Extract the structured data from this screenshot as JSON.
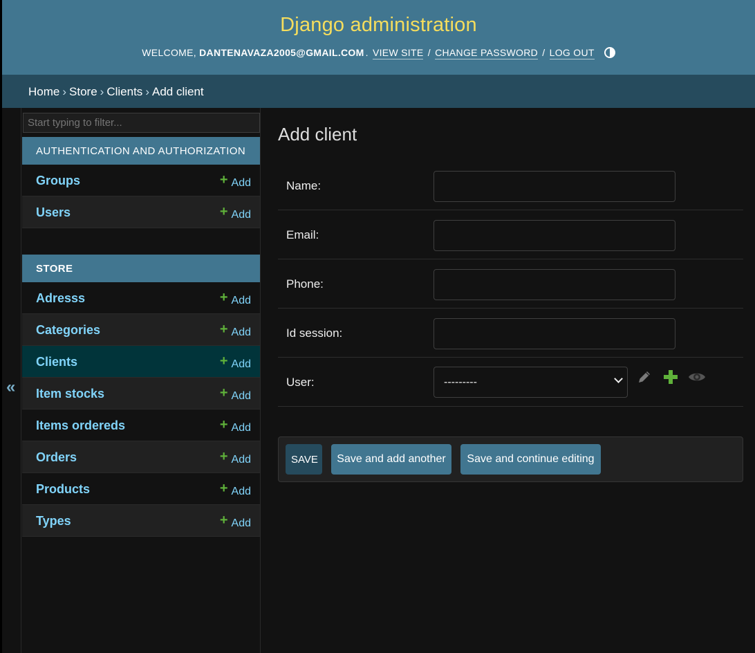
{
  "header": {
    "site_name": "Django administration",
    "welcome": "Welcome,",
    "user": "dantenavaza2005@gmail.com",
    "view_site": "View site",
    "change_password": "Change password",
    "log_out": "Log out"
  },
  "breadcrumbs": {
    "home": "Home",
    "store": "Store",
    "clients": "Clients",
    "current": "Add client",
    "separator": "›"
  },
  "sidebar": {
    "filter_placeholder": "Start typing to filter...",
    "collapse_icon": "«",
    "add_label": "Add",
    "auth_caption": "Authentication and Authorization",
    "auth_models": [
      {
        "label": "Groups"
      },
      {
        "label": "Users"
      }
    ],
    "store_caption": "Store",
    "store_models": [
      {
        "label": "Adresss"
      },
      {
        "label": "Categories"
      },
      {
        "label": "Clients",
        "current": true
      },
      {
        "label": "Item stocks"
      },
      {
        "label": "Items ordereds"
      },
      {
        "label": "Orders"
      },
      {
        "label": "Products"
      },
      {
        "label": "Types"
      }
    ]
  },
  "content": {
    "title": "Add client",
    "fields": {
      "name_label": "Name:",
      "email_label": "Email:",
      "phone_label": "Phone:",
      "id_session_label": "Id session:",
      "user_label": "User:",
      "user_selected": "---------"
    },
    "buttons": {
      "save": "Save",
      "save_add_another": "Save and add another",
      "save_continue": "Save and continue editing"
    }
  },
  "colors": {
    "header_bg": "#417690",
    "site_name": "#f5dd5d",
    "breadcrumbs_bg": "#264b5d",
    "link": "#81d4fa",
    "add_icon": "#5fb13a",
    "current_row": "#01343a"
  }
}
